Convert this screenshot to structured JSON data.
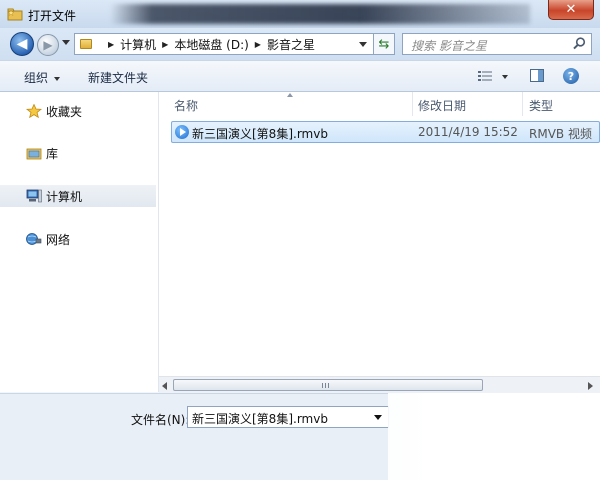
{
  "window": {
    "title": "打开文件",
    "close_label": "✕"
  },
  "address": {
    "crumbs": [
      "计算机",
      "本地磁盘 (D:)",
      "影音之星"
    ],
    "search_placeholder": "搜索 影音之星"
  },
  "toolbar": {
    "organize_label": "组织",
    "new_folder_label": "新建文件夹",
    "help_label": "?"
  },
  "nav": {
    "items": [
      {
        "label": "收藏夹",
        "icon": "star-icon"
      },
      {
        "label": "库",
        "icon": "library-icon"
      },
      {
        "label": "计算机",
        "icon": "computer-icon",
        "selected": true
      },
      {
        "label": "网络",
        "icon": "network-icon"
      }
    ]
  },
  "columns": {
    "name": "名称",
    "modified": "修改日期",
    "type": "类型"
  },
  "files": [
    {
      "name": "新三国演义[第8集].rmvb",
      "modified": "2011/4/19 15:52",
      "type": "RMVB 视频",
      "icon": "media-file-icon",
      "selected": true
    }
  ],
  "footer": {
    "filename_label": "文件名(N):",
    "filename_value": "新三国演义[第8集].rmvb"
  }
}
